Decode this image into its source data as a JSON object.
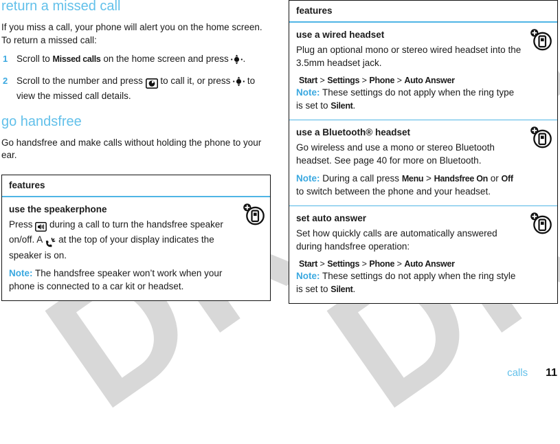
{
  "document": {
    "watermark_text": "DRAFT",
    "accent_blue": "#62c0ea",
    "rule_blue": "#4fb5e5",
    "text_color": "#1a1a1a"
  },
  "left_column": {
    "heading_1": "return a missed call",
    "intro_1": "If you miss a call, your phone will alert you on the home screen. To return a missed call:",
    "steps": [
      {
        "num": "1",
        "pre": "Scroll to ",
        "cond": "Missed calls",
        "mid": " on the home screen and press ",
        "icon": "nav-key-icon",
        "post": "."
      },
      {
        "num": "2",
        "pre": "Scroll to the number and press ",
        "icon": "call-key-icon",
        "mid": " to call it, or press ",
        "icon2": "nav-key-icon",
        "post": " to view the missed call details."
      }
    ],
    "heading_2": "go handsfree",
    "intro_2": "Go handsfree and make calls without holding the phone to your ear.",
    "table": {
      "header": "features",
      "rows": [
        {
          "title": "use the speakerphone",
          "icon": "phone-feature-icon",
          "body_pre": "Press ",
          "body_icon": "speaker-key-icon",
          "body_mid": " during a call to turn the handsfree speaker on/off. A ",
          "body_icon2": "handsfree-indicator-icon",
          "body_post": " at the top of your display indicates the speaker is on.",
          "note_label": "Note:",
          "note_text": " The handsfree speaker won’t work when your phone is connected to a car kit or headset."
        }
      ]
    }
  },
  "right_column": {
    "table": {
      "header": "features",
      "rows": [
        {
          "title": "use a wired headset",
          "icon": "phone-feature-icon",
          "body": "Plug an optional mono or stereo wired headset into the 3.5mm headset jack.",
          "path": [
            "Start",
            "Settings",
            "Phone",
            "Auto Answer"
          ],
          "note_label": "Note:",
          "note_pre": " These settings do not apply when the ring type is set to ",
          "note_cond": "Silent",
          "note_post": "."
        },
        {
          "title": "use a Bluetooth® headset",
          "icon": "phone-feature-icon",
          "body": "Go wireless and use a mono or stereo Bluetooth headset. See page 40 for more on Bluetooth.",
          "note_label": "Note:",
          "note_pre": " During a call press ",
          "note_cond_1": "Menu",
          "note_sep": " > ",
          "note_cond_2": "Handsfree On",
          "note_mid": " or ",
          "note_cond_3": "Off",
          "note_post": " to switch between the phone and your headset."
        },
        {
          "title": "set auto answer",
          "icon": "phone-feature-icon",
          "body": "Set how quickly calls are automatically answered during handsfree operation:",
          "path": [
            "Start",
            "Settings",
            "Phone",
            "Auto Answer"
          ],
          "note_label": "Note:",
          "note_pre": " These settings do not apply when the ring style is set to ",
          "note_cond": "Silent",
          "note_post": "."
        }
      ]
    }
  },
  "footer": {
    "chapter": "calls",
    "page_number": "11"
  }
}
